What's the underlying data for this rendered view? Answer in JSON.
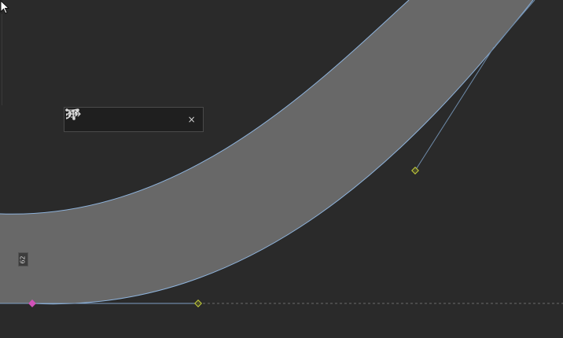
{
  "canvas": {
    "background": "#2a2a2a",
    "shape_fill": "#686868",
    "shape_stroke": "#8fb4dd",
    "handle_color": "#c4cf3a",
    "start_node_color": "#d052b8"
  },
  "context_toolbar": {
    "buttons": [
      {
        "name": "add-node-icon"
      },
      {
        "name": "convert-node-icon"
      },
      {
        "name": "break-curve-icon"
      },
      {
        "name": "smooth-node-icon"
      },
      {
        "name": "reverse-direction-icon"
      }
    ],
    "close_label": "×"
  },
  "dimension_tag": {
    "label": "62"
  }
}
